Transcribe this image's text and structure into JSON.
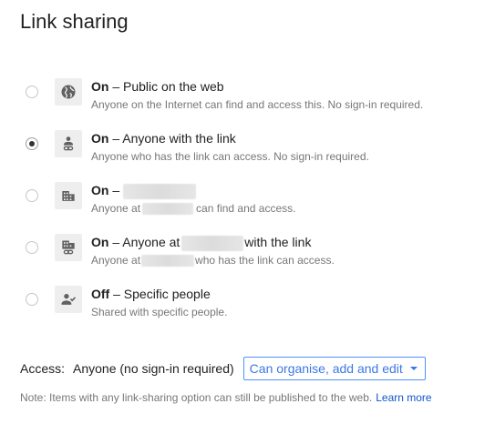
{
  "dialog": {
    "title": "Link sharing"
  },
  "options": [
    {
      "state": "On",
      "label": " – Public on the web",
      "description": "Anyone on the Internet can find and access this. No sign-in required.",
      "icon": "globe-icon",
      "selected": false
    },
    {
      "state": "On",
      "label": " – Anyone with the link",
      "description": "Anyone who has the link can access. No sign-in required.",
      "icon": "person-link-icon",
      "selected": true
    },
    {
      "state": "On",
      "label": " –",
      "desc_prefix": "Anyone at",
      "desc_suffix": "can find and access.",
      "icon": "building-icon",
      "selected": false
    },
    {
      "state": "On",
      "label": " – Anyone at",
      "label_suffix": "with the link",
      "desc_prefix": "Anyone at",
      "desc_suffix": "who has the link can access.",
      "icon": "building-link-icon",
      "selected": false
    },
    {
      "state": "Off",
      "label": " – Specific people",
      "description": "Shared with specific people.",
      "icon": "person-icon",
      "selected": false
    }
  ],
  "access": {
    "label": "Access:",
    "value": "Anyone (no sign-in required)",
    "permission": "Can organise, add and edit"
  },
  "note": {
    "text": "Note: Items with any link-sharing option can still be published to the web.",
    "link": "Learn more"
  },
  "colors": {
    "accent": "#3b78e7",
    "link": "#1155cc",
    "secondary_text": "#777777"
  }
}
